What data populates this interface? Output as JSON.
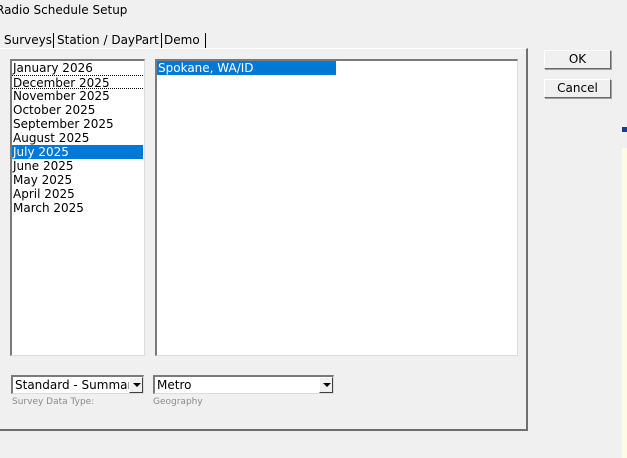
{
  "window": {
    "title": "Radio Schedule Setup"
  },
  "tabs": [
    {
      "label": "Surveys",
      "active": true
    },
    {
      "label": "Station / DayPart",
      "active": false
    },
    {
      "label": "Demo",
      "active": false
    }
  ],
  "surveys": {
    "items": [
      "January 2026",
      "December 2025",
      "November 2025",
      "October 2025",
      "September 2025",
      "August 2025",
      "July 2025",
      "June 2025",
      "May 2025",
      "April 2025",
      "March 2025"
    ],
    "selected_index": 6,
    "focused_index": 1
  },
  "geography_list": {
    "items": [
      "Spokane, WA/ID"
    ],
    "selected_index": 0
  },
  "survey_data_type": {
    "value": "Standard - Summary",
    "caption": "Survey Data Type:"
  },
  "geography": {
    "value": "Metro",
    "caption": "Geography"
  },
  "buttons": {
    "ok": "OK",
    "cancel": "Cancel"
  },
  "colors": {
    "selection": "#0078d7",
    "window_bg": "#f0f0f0"
  }
}
